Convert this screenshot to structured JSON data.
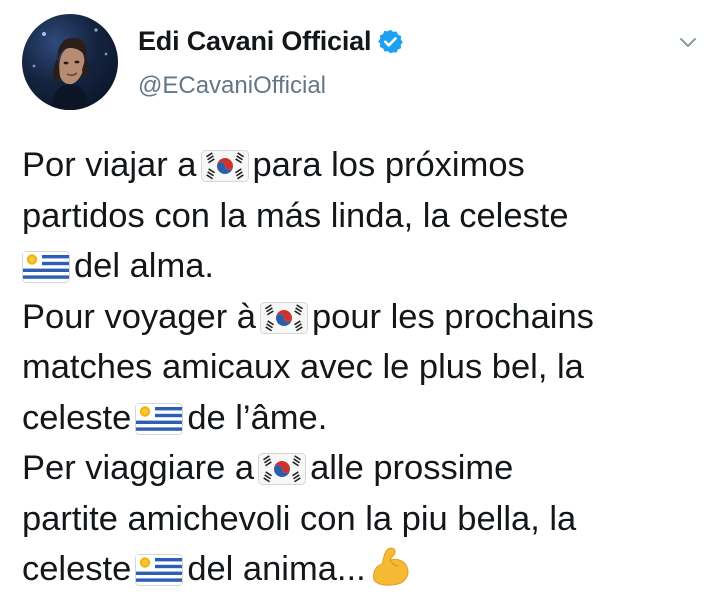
{
  "author": {
    "display_name": "Edi Cavani Official",
    "handle": "@ECavaniOfficial"
  },
  "icons": {
    "verified": "verified-badge-icon",
    "more": "chevron-down-icon",
    "korea": "south-korea-flag-emoji",
    "uruguay": "uruguay-flag-emoji",
    "flex": "flexed-biceps-emoji"
  },
  "colors": {
    "verified_blue": "#1da1f2",
    "handle_gray": "#657786",
    "text": "#14171a"
  },
  "tweet": {
    "l1a": "Por viajar a",
    "l1b": "para los próximos",
    "l2": "partidos con la más linda, la celeste",
    "l3": "del alma.",
    "l4a": "Pour voyager à",
    "l4b": "pour les prochains",
    "l5": "matches amicaux avec le plus bel, la",
    "l6a": "celeste",
    "l6b": "de l’âme.",
    "l7a": "Per viaggiare a",
    "l7b": "alle prossime",
    "l8": "partite amichevoli con la piu bella, la",
    "l9a": "celeste",
    "l9b": "del anima..."
  }
}
